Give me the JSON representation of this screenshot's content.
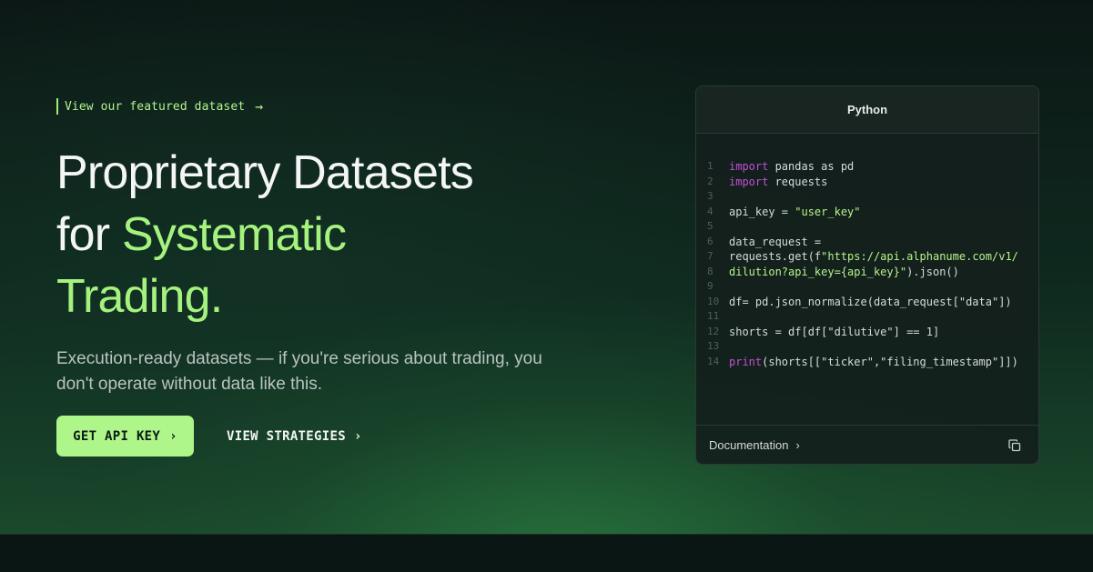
{
  "featured": {
    "label": "View our featured dataset",
    "arrow": "→"
  },
  "hero": {
    "title_line1": "Proprietary Datasets",
    "title_line2_plain": "for ",
    "title_line2_accent": "Systematic",
    "title_line3_accent": "Trading.",
    "subtitle": "Execution-ready datasets — if you're serious about trading, you don't operate without data like this."
  },
  "buttons": {
    "primary_label": "GET API KEY",
    "primary_chevron": "›",
    "secondary_label": "VIEW STRATEGIES",
    "secondary_chevron": "›"
  },
  "code_card": {
    "language": "Python",
    "lines": [
      {
        "n": "1",
        "parts": [
          {
            "t": "import",
            "c": "kw"
          },
          {
            "t": " pandas as pd",
            "c": "txt"
          }
        ]
      },
      {
        "n": "2",
        "parts": [
          {
            "t": "import",
            "c": "kw"
          },
          {
            "t": " requests",
            "c": "txt"
          }
        ]
      },
      {
        "n": "3",
        "parts": []
      },
      {
        "n": "4",
        "parts": [
          {
            "t": "api_key = ",
            "c": "txt"
          },
          {
            "t": "\"user_key\"",
            "c": "str"
          }
        ]
      },
      {
        "n": "5",
        "parts": []
      },
      {
        "n": "6",
        "parts": [
          {
            "t": "data_request =",
            "c": "txt"
          }
        ]
      },
      {
        "n": "7",
        "parts": [
          {
            "t": "requests.get(f",
            "c": "txt"
          },
          {
            "t": "\"https://api.alphanume.com/v1/",
            "c": "str"
          }
        ]
      },
      {
        "n": "8",
        "parts": [
          {
            "t": "dilution?api_key={api_key}\"",
            "c": "str"
          },
          {
            "t": ").json()",
            "c": "txt"
          }
        ]
      },
      {
        "n": "9",
        "parts": []
      },
      {
        "n": "10",
        "parts": [
          {
            "t": "df= pd.json_normalize(data_request[\"data\"])",
            "c": "txt"
          }
        ]
      },
      {
        "n": "11",
        "parts": []
      },
      {
        "n": "12",
        "parts": [
          {
            "t": "shorts = df[df[\"dilutive\"] == 1]",
            "c": "txt"
          }
        ]
      },
      {
        "n": "13",
        "parts": []
      },
      {
        "n": "14",
        "parts": [
          {
            "t": "print",
            "c": "kw"
          },
          {
            "t": "(shorts[[\"ticker\",\"filing_timestamp\"]])",
            "c": "txt"
          }
        ]
      }
    ],
    "footer_link": "Documentation",
    "footer_chevron": "›",
    "copy_icon": "copy-icon"
  },
  "colors": {
    "accent": "#a6f27f",
    "button_bg": "#aef58a",
    "keyword": "#c34fd6",
    "string": "#b8f38c"
  }
}
